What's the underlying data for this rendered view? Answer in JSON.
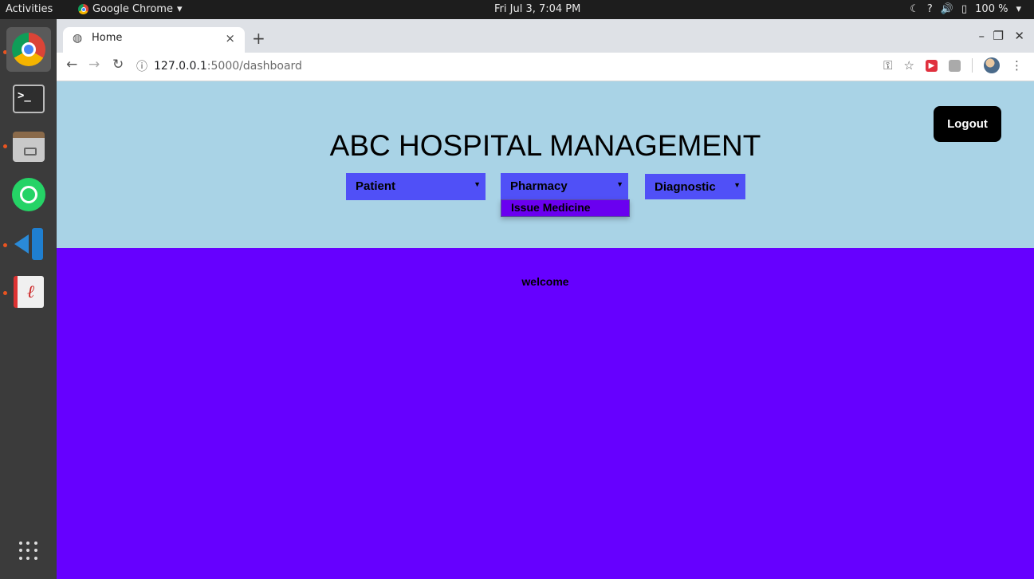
{
  "system_bar": {
    "activities": "Activities",
    "app_name": "Google Chrome",
    "clock": "Fri Jul  3,  7:04 PM",
    "battery": "100 %"
  },
  "dock": {
    "apps": [
      "chrome",
      "terminal",
      "files",
      "whatsapp",
      "vscode",
      "document-viewer"
    ],
    "show_apps_icon": "grid-icon"
  },
  "browser": {
    "tab_title": "Home",
    "tab_close": "×",
    "new_tab": "+",
    "url_host": "127.0.0.1",
    "url_rest": ":5000/dashboard"
  },
  "page": {
    "title": "ABC HOSPITAL MANAGEMENT",
    "logout_label": "Logout",
    "menus": [
      {
        "label": "Patient"
      },
      {
        "label": "Pharmacy"
      },
      {
        "label": "Diagnostic"
      }
    ],
    "pharmacy_open_item": "Issue Medicine",
    "welcome_text": "welcome",
    "colors": {
      "header_bg": "#a9d3e6",
      "content_bg": "#6600ff",
      "menu_bg": "#5050f7",
      "dropdown_bg": "#6a00f0",
      "logout_bg": "#000000"
    }
  }
}
